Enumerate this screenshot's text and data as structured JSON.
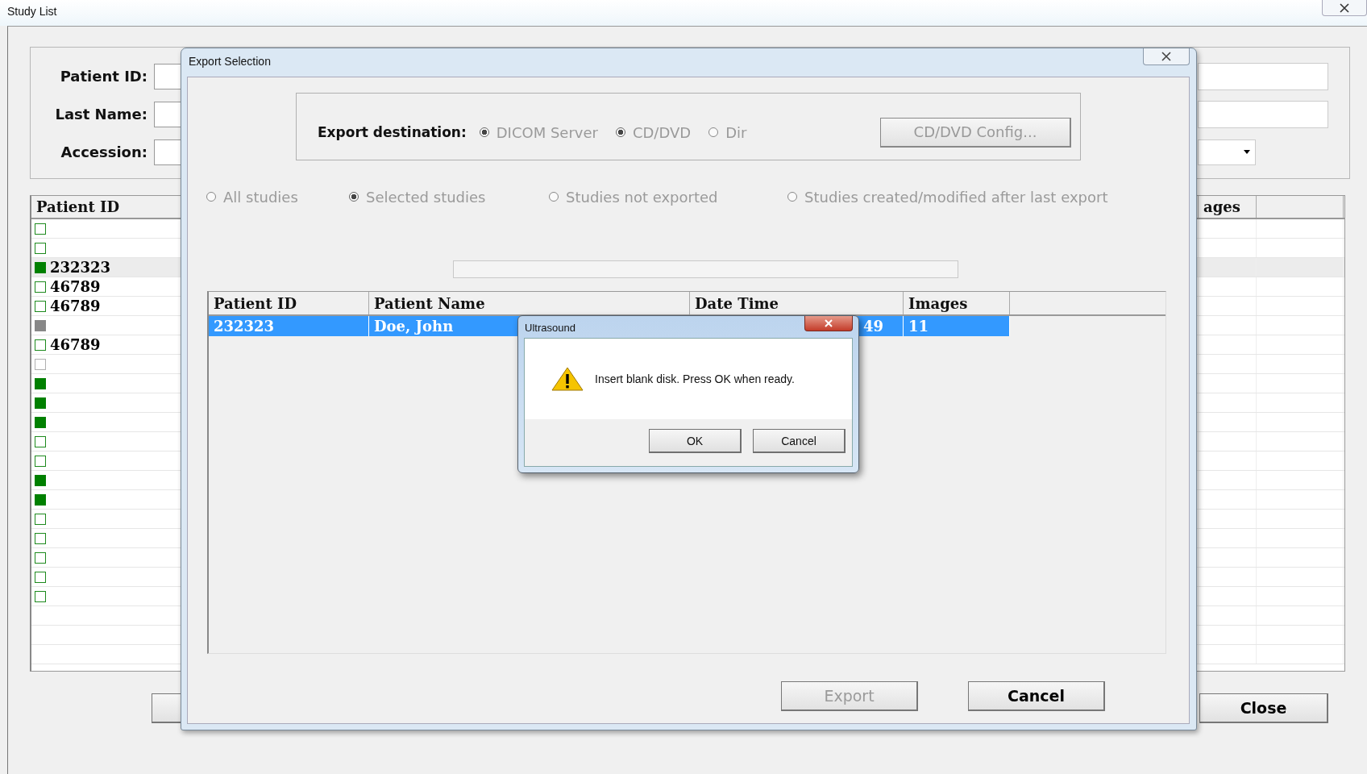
{
  "window": {
    "title": "Study List"
  },
  "search": {
    "fields": [
      {
        "label": "Patient ID:"
      },
      {
        "label": "Last Name:"
      },
      {
        "label": "Accession:"
      }
    ]
  },
  "study_table": {
    "columns": [
      "Patient ID",
      "ages"
    ],
    "rows": [
      {
        "checked": false,
        "disabled": false,
        "selected": false
      },
      {
        "checked": false,
        "disabled": false,
        "selected": false
      },
      {
        "patient_id": "232323",
        "checked": true,
        "disabled": false,
        "selected": true
      },
      {
        "patient_id": "46789",
        "checked": false,
        "disabled": false,
        "selected": false
      },
      {
        "patient_id": "46789",
        "checked": false,
        "disabled": false,
        "selected": false
      },
      {
        "checked": true,
        "disabled": true,
        "selected": false
      },
      {
        "patient_id": "46789",
        "checked": false,
        "disabled": false,
        "selected": false
      },
      {
        "checked": false,
        "disabled": true,
        "selected": false
      },
      {
        "checked": true,
        "disabled": false,
        "selected": false
      },
      {
        "checked": true,
        "disabled": false,
        "selected": false
      },
      {
        "checked": true,
        "disabled": false,
        "selected": false
      },
      {
        "checked": false,
        "disabled": false,
        "selected": false
      },
      {
        "checked": false,
        "disabled": false,
        "selected": false
      },
      {
        "checked": true,
        "disabled": false,
        "selected": false
      },
      {
        "checked": true,
        "disabled": false,
        "selected": false
      },
      {
        "checked": false,
        "disabled": false,
        "selected": false
      },
      {
        "checked": false,
        "disabled": false,
        "selected": false
      },
      {
        "checked": false,
        "disabled": false,
        "selected": false
      },
      {
        "checked": false,
        "disabled": false,
        "selected": false
      },
      {
        "checked": false,
        "disabled": false,
        "selected": false
      }
    ]
  },
  "close_button": "Close",
  "export_dialog": {
    "title": "Export Selection",
    "destination": {
      "label": "Export destination:",
      "options": [
        {
          "label": "DICOM Server",
          "selected": true,
          "disabled": true
        },
        {
          "label": "CD/DVD",
          "selected": true,
          "disabled": true
        },
        {
          "label": "Dir",
          "selected": false,
          "disabled": true
        }
      ],
      "config_button": {
        "label": "CD/DVD Config...",
        "disabled": true
      }
    },
    "scope": [
      {
        "label": "All studies",
        "selected": false,
        "disabled": true
      },
      {
        "label": "Selected studies",
        "selected": true,
        "disabled": true
      },
      {
        "label": "Studies not exported",
        "selected": false,
        "disabled": true
      },
      {
        "label": "Studies created/modified after last export",
        "selected": false,
        "disabled": true
      }
    ],
    "progress": {
      "level": 0
    },
    "table": {
      "columns": [
        "Patient ID",
        "Patient Name",
        "Date Time",
        "Images"
      ],
      "rows": [
        {
          "cells": [
            "232323",
            "Doe, John",
            "49",
            "11"
          ],
          "selected": true
        }
      ]
    },
    "buttons": [
      {
        "label": "Export",
        "disabled": true
      },
      {
        "label": "Cancel",
        "disabled": false
      }
    ]
  },
  "message_box": {
    "title": "Ultrasound",
    "message": "Insert blank disk. Press OK when ready.",
    "buttons": [
      "OK",
      "Cancel"
    ]
  }
}
